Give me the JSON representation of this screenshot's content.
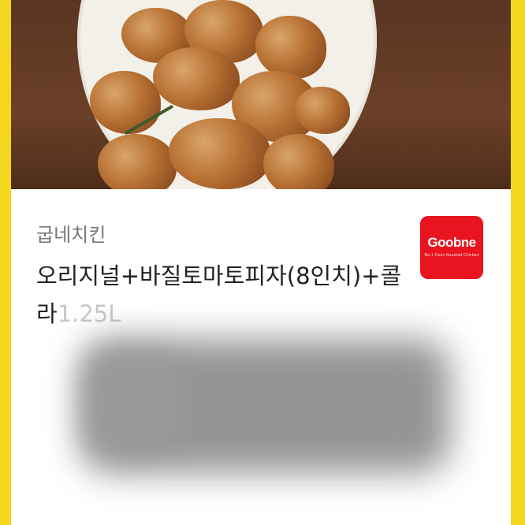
{
  "product": {
    "brand": "굽네치킨",
    "title_main": "오리지널+바질토마토피자(8인치)+콜라",
    "title_faded": "1.25L"
  },
  "logo": {
    "text": "Goobne",
    "subtext": "No.1 Oven Roasted Chicken",
    "color": "#e8141f"
  },
  "colors": {
    "frame": "#f5d61e",
    "card": "#ffffff"
  }
}
